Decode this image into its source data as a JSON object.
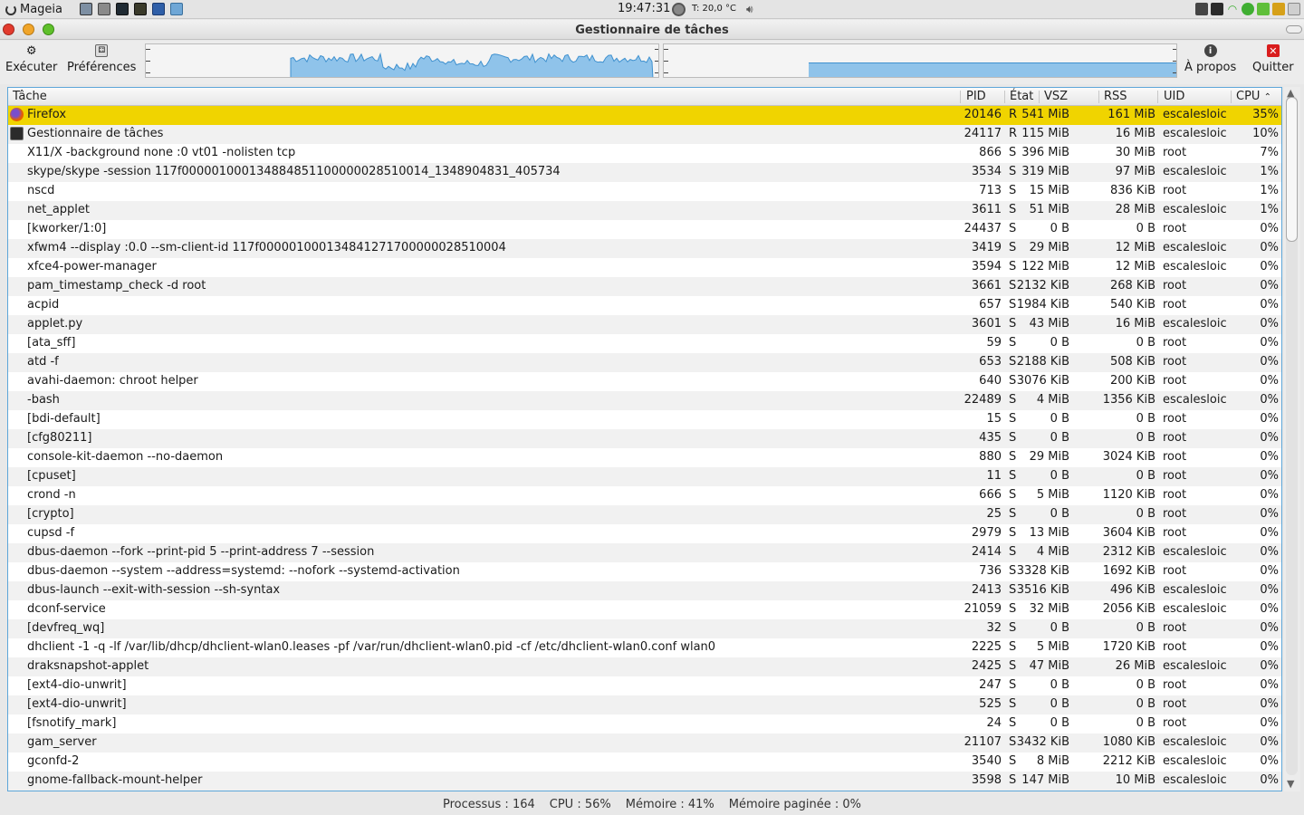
{
  "panel": {
    "menu_label": "Mageia",
    "clock": "19:47:31",
    "temperature": "T: 20,0 °C",
    "launchers": [
      "app-launcher-1",
      "app-launcher-2",
      "terminal",
      "task-manager",
      "app-launcher-5",
      "app-launcher-6"
    ]
  },
  "window": {
    "title": "Gestionnaire de tâches"
  },
  "toolbar": {
    "run_label": "Exécuter",
    "prefs_label": "Préférences",
    "about_label": "À propos",
    "quit_label": "Quitter"
  },
  "colors": {
    "selection": "#f0d400",
    "graph": "#5aa8de",
    "quit": "#d91c1c",
    "border_accent": "#5da6d9"
  },
  "graphs": {
    "cpu_percent": 56,
    "memory_percent": 41
  },
  "table": {
    "columns": [
      "Tâche",
      "PID",
      "État",
      "VSZ",
      "RSS",
      "UID",
      "CPU"
    ],
    "sort_column": "CPU",
    "rows": [
      {
        "task": "Firefox",
        "pid": "20146",
        "state": "R",
        "vsz": "541 MiB",
        "rss": "161 MiB",
        "uid": "escalesloic",
        "cpu": "35%",
        "icon": "firefox-icon",
        "selected": true
      },
      {
        "task": "Gestionnaire de tâches",
        "pid": "24117",
        "state": "R",
        "vsz": "115 MiB",
        "rss": "16 MiB",
        "uid": "escalesloic",
        "cpu": "10%",
        "icon": "task-manager-icon"
      },
      {
        "task": "X11/X -background none :0 vt01 -nolisten tcp",
        "pid": "866",
        "state": "S",
        "vsz": "396 MiB",
        "rss": "30 MiB",
        "uid": "root",
        "cpu": "7%"
      },
      {
        "task": "skype/skype -session 117f000001000134884851100000028510014_1348904831_405734",
        "pid": "3534",
        "state": "S",
        "vsz": "319 MiB",
        "rss": "97 MiB",
        "uid": "escalesloic",
        "cpu": "1%"
      },
      {
        "task": "nscd",
        "pid": "713",
        "state": "S",
        "vsz": "15 MiB",
        "rss": "836 KiB",
        "uid": "root",
        "cpu": "1%"
      },
      {
        "task": "net_applet",
        "pid": "3611",
        "state": "S",
        "vsz": "51 MiB",
        "rss": "28 MiB",
        "uid": "escalesloic",
        "cpu": "1%"
      },
      {
        "task": "[kworker/1:0]",
        "pid": "24437",
        "state": "S",
        "vsz": "0 B",
        "rss": "0 B",
        "uid": "root",
        "cpu": "0%"
      },
      {
        "task": "xfwm4 --display :0.0 --sm-client-id 117f000001000134841271700000028510004",
        "pid": "3419",
        "state": "S",
        "vsz": "29 MiB",
        "rss": "12 MiB",
        "uid": "escalesloic",
        "cpu": "0%"
      },
      {
        "task": "xfce4-power-manager",
        "pid": "3594",
        "state": "S",
        "vsz": "122 MiB",
        "rss": "12 MiB",
        "uid": "escalesloic",
        "cpu": "0%"
      },
      {
        "task": "pam_timestamp_check -d root",
        "pid": "3661",
        "state": "S",
        "vsz": "2132 KiB",
        "rss": "268 KiB",
        "uid": "root",
        "cpu": "0%"
      },
      {
        "task": "acpid",
        "pid": "657",
        "state": "S",
        "vsz": "1984 KiB",
        "rss": "540 KiB",
        "uid": "root",
        "cpu": "0%"
      },
      {
        "task": "applet.py",
        "pid": "3601",
        "state": "S",
        "vsz": "43 MiB",
        "rss": "16 MiB",
        "uid": "escalesloic",
        "cpu": "0%"
      },
      {
        "task": "[ata_sff]",
        "pid": "59",
        "state": "S",
        "vsz": "0 B",
        "rss": "0 B",
        "uid": "root",
        "cpu": "0%"
      },
      {
        "task": "atd -f",
        "pid": "653",
        "state": "S",
        "vsz": "2188 KiB",
        "rss": "508 KiB",
        "uid": "root",
        "cpu": "0%"
      },
      {
        "task": "avahi-daemon: chroot helper",
        "pid": "640",
        "state": "S",
        "vsz": "3076 KiB",
        "rss": "200 KiB",
        "uid": "root",
        "cpu": "0%"
      },
      {
        "task": "-bash",
        "pid": "22489",
        "state": "S",
        "vsz": "4 MiB",
        "rss": "1356 KiB",
        "uid": "escalesloic",
        "cpu": "0%"
      },
      {
        "task": "[bdi-default]",
        "pid": "15",
        "state": "S",
        "vsz": "0 B",
        "rss": "0 B",
        "uid": "root",
        "cpu": "0%"
      },
      {
        "task": "[cfg80211]",
        "pid": "435",
        "state": "S",
        "vsz": "0 B",
        "rss": "0 B",
        "uid": "root",
        "cpu": "0%"
      },
      {
        "task": "console-kit-daemon --no-daemon",
        "pid": "880",
        "state": "S",
        "vsz": "29 MiB",
        "rss": "3024 KiB",
        "uid": "root",
        "cpu": "0%"
      },
      {
        "task": "[cpuset]",
        "pid": "11",
        "state": "S",
        "vsz": "0 B",
        "rss": "0 B",
        "uid": "root",
        "cpu": "0%"
      },
      {
        "task": "crond -n",
        "pid": "666",
        "state": "S",
        "vsz": "5 MiB",
        "rss": "1120 KiB",
        "uid": "root",
        "cpu": "0%"
      },
      {
        "task": "[crypto]",
        "pid": "25",
        "state": "S",
        "vsz": "0 B",
        "rss": "0 B",
        "uid": "root",
        "cpu": "0%"
      },
      {
        "task": "cupsd -f",
        "pid": "2979",
        "state": "S",
        "vsz": "13 MiB",
        "rss": "3604 KiB",
        "uid": "root",
        "cpu": "0%"
      },
      {
        "task": "dbus-daemon --fork --print-pid 5 --print-address 7 --session",
        "pid": "2414",
        "state": "S",
        "vsz": "4 MiB",
        "rss": "2312 KiB",
        "uid": "escalesloic",
        "cpu": "0%"
      },
      {
        "task": "dbus-daemon --system --address=systemd: --nofork --systemd-activation",
        "pid": "736",
        "state": "S",
        "vsz": "3328 KiB",
        "rss": "1692 KiB",
        "uid": "root",
        "cpu": "0%"
      },
      {
        "task": "dbus-launch --exit-with-session --sh-syntax",
        "pid": "2413",
        "state": "S",
        "vsz": "3516 KiB",
        "rss": "496 KiB",
        "uid": "escalesloic",
        "cpu": "0%"
      },
      {
        "task": "dconf-service",
        "pid": "21059",
        "state": "S",
        "vsz": "32 MiB",
        "rss": "2056 KiB",
        "uid": "escalesloic",
        "cpu": "0%"
      },
      {
        "task": "[devfreq_wq]",
        "pid": "32",
        "state": "S",
        "vsz": "0 B",
        "rss": "0 B",
        "uid": "root",
        "cpu": "0%"
      },
      {
        "task": "dhclient -1 -q -lf /var/lib/dhcp/dhclient-wlan0.leases -pf /var/run/dhclient-wlan0.pid -cf /etc/dhclient-wlan0.conf wlan0",
        "pid": "2225",
        "state": "S",
        "vsz": "5 MiB",
        "rss": "1720 KiB",
        "uid": "root",
        "cpu": "0%"
      },
      {
        "task": "draksnapshot-applet",
        "pid": "2425",
        "state": "S",
        "vsz": "47 MiB",
        "rss": "26 MiB",
        "uid": "escalesloic",
        "cpu": "0%"
      },
      {
        "task": "[ext4-dio-unwrit]",
        "pid": "247",
        "state": "S",
        "vsz": "0 B",
        "rss": "0 B",
        "uid": "root",
        "cpu": "0%"
      },
      {
        "task": "[ext4-dio-unwrit]",
        "pid": "525",
        "state": "S",
        "vsz": "0 B",
        "rss": "0 B",
        "uid": "root",
        "cpu": "0%"
      },
      {
        "task": "[fsnotify_mark]",
        "pid": "24",
        "state": "S",
        "vsz": "0 B",
        "rss": "0 B",
        "uid": "root",
        "cpu": "0%"
      },
      {
        "task": "gam_server",
        "pid": "21107",
        "state": "S",
        "vsz": "3432 KiB",
        "rss": "1080 KiB",
        "uid": "escalesloic",
        "cpu": "0%"
      },
      {
        "task": "gconfd-2",
        "pid": "3540",
        "state": "S",
        "vsz": "8 MiB",
        "rss": "2212 KiB",
        "uid": "escalesloic",
        "cpu": "0%"
      },
      {
        "task": "gnome-fallback-mount-helper",
        "pid": "3598",
        "state": "S",
        "vsz": "147 MiB",
        "rss": "10 MiB",
        "uid": "escalesloic",
        "cpu": "0%"
      }
    ]
  },
  "status": {
    "processes": "Processus : 164",
    "cpu": "CPU : 56%",
    "memory": "Mémoire : 41%",
    "swap": "Mémoire paginée : 0%"
  }
}
